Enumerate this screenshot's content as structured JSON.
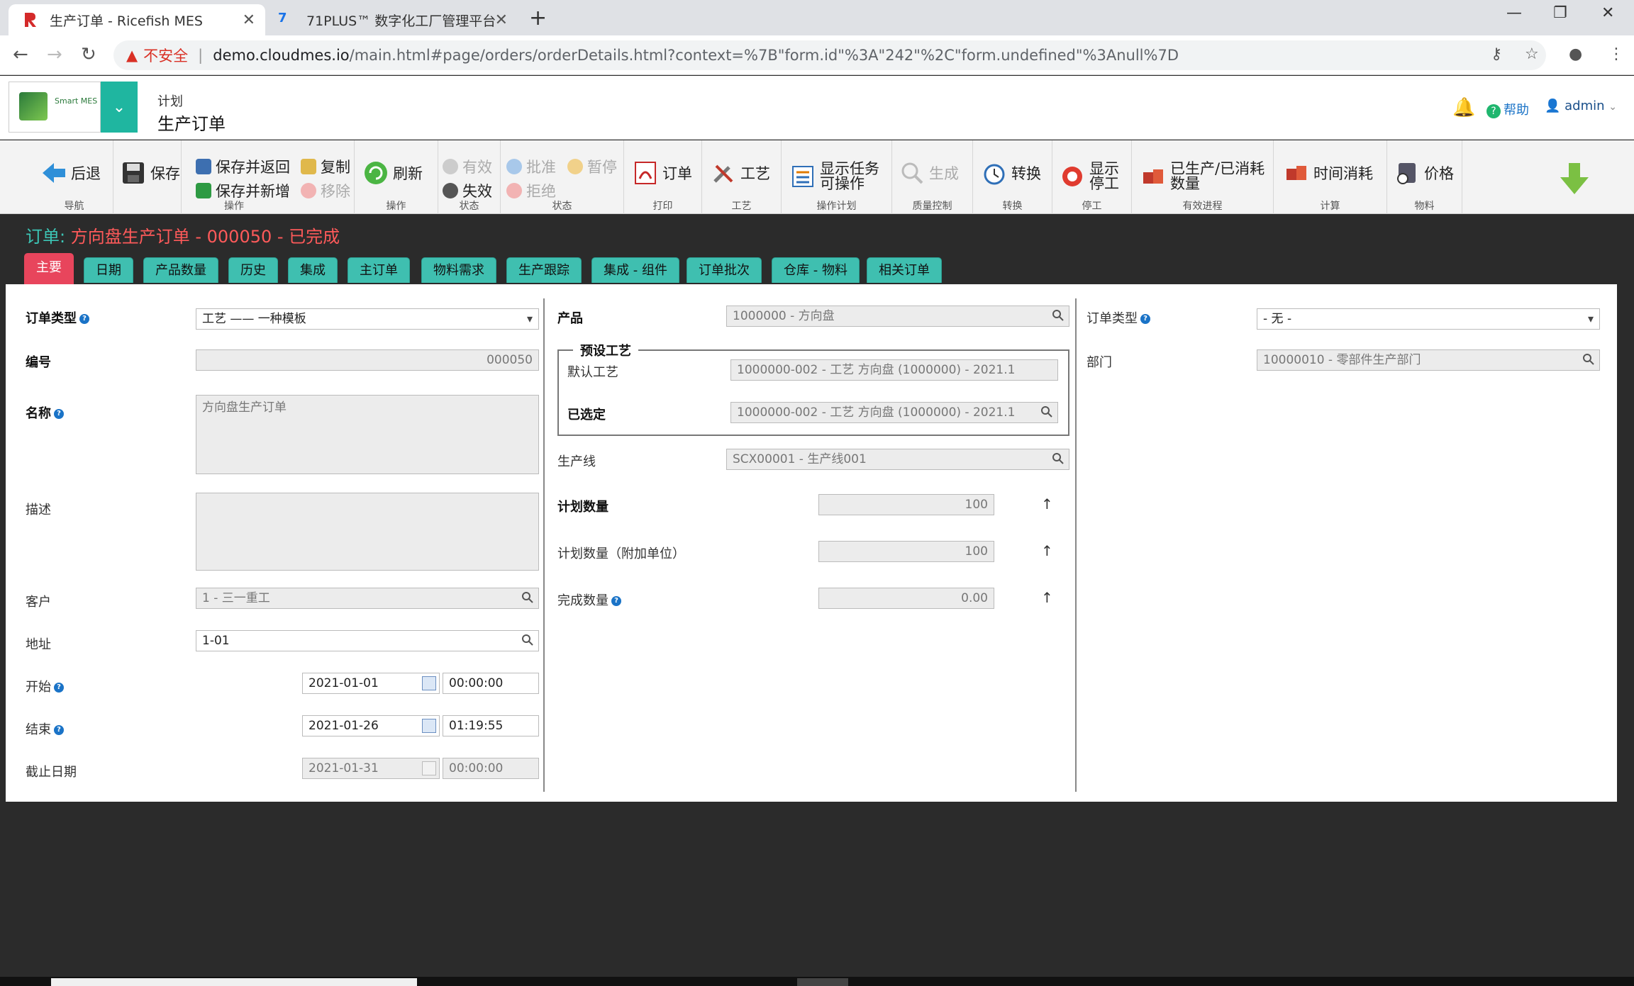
{
  "browser": {
    "tabs": [
      {
        "title": "生产订单 - Ricefish MES",
        "active": true
      },
      {
        "title": "71PLUS™ 数字化工厂管理平台",
        "active": false
      }
    ],
    "insecure_label": "不安全",
    "url_host": "demo.cloudmes.io",
    "url_path": "/main.html#page/orders/orderDetails.html?context=%7B\"form.id\"%3A\"242\"%2C\"form.undefined\"%3Anull%7D"
  },
  "header": {
    "logo_text": "Smart MES",
    "breadcrumb_parent": "计划",
    "page_title": "生产订单",
    "help_label": "帮助",
    "user_name": "admin"
  },
  "toolbar": {
    "back": "后退",
    "save": "保存",
    "save_return": "保存并返回",
    "save_new": "保存并新增",
    "copy": "复制",
    "remove": "移除",
    "refresh": "刷新",
    "valid": "有效",
    "invalid": "失效",
    "approve": "批准",
    "reject": "拒绝",
    "pause": "暂停",
    "order": "订单",
    "process": "工艺",
    "show_tasks_l1": "显示任务",
    "show_tasks_l2": "可操作",
    "generate": "生成",
    "convert": "转换",
    "show_stop_l1": "显示",
    "show_stop_l2": "停工",
    "produced_l1": "已生产/已消耗",
    "produced_l2": "数量",
    "time_consume": "时间消耗",
    "price": "价格",
    "groups": {
      "nav": "导航",
      "ops1": "操作",
      "ops2": "操作",
      "status1": "状态",
      "status2": "状态",
      "print": "打印",
      "process": "工艺",
      "op_plan": "操作计划",
      "quality": "质量控制",
      "convert": "转换",
      "stop": "停工",
      "progress": "有效进程",
      "calc": "计算",
      "material": "物料"
    }
  },
  "content": {
    "title_label": "订单: ",
    "title_value": "方向盘生产订单 - 000050 - 已完成"
  },
  "tabs": [
    "主要",
    "日期",
    "产品数量",
    "历史",
    "集成",
    "主订单",
    "物料需求",
    "生产跟踪",
    "集成 - 组件",
    "订单批次",
    "仓库 - 物料",
    "相关订单"
  ],
  "form": {
    "left": {
      "order_type_label": "订单类型",
      "order_type_value": "工艺 —— 一种模板",
      "number_label": "编号",
      "number_value": "000050",
      "name_label": "名称",
      "name_value": "方向盘生产订单",
      "desc_label": "描述",
      "desc_value": "",
      "customer_label": "客户",
      "customer_value": "1 - 三一重工",
      "address_label": "地址",
      "address_value": "1-01",
      "start_label": "开始",
      "start_date": "2021-01-01",
      "start_time": "00:00:00",
      "end_label": "结束",
      "end_date": "2021-01-26",
      "end_time": "01:19:55",
      "deadline_label": "截止日期",
      "deadline_date": "2021-01-31",
      "deadline_time": "00:00:00"
    },
    "middle": {
      "product_label": "产品",
      "product_value": "1000000 - 方向盘",
      "preset_legend": "预设工艺",
      "default_process_label": "默认工艺",
      "default_process_value": "1000000-002 - 工艺 方向盘 (1000000) - 2021.1",
      "selected_label": "已选定",
      "selected_value": "1000000-002 - 工艺 方向盘 (1000000) - 2021.1",
      "line_label": "生产线",
      "line_value": "SCX00001 - 生产线001",
      "planned_qty_label": "计划数量",
      "planned_qty_value": "100",
      "planned_qty_add_label": "计划数量（附加单位）",
      "planned_qty_add_value": "100",
      "done_qty_label": "完成数量",
      "done_qty_value": "0.00"
    },
    "right": {
      "order_type_label": "订单类型",
      "order_type_value": "- 无 -",
      "dept_label": "部门",
      "dept_value": "10000010 - 零部件生产部门"
    }
  },
  "colors": {
    "teal": "#1fb6a0",
    "tab_active": "#e8455c",
    "title_red": "#ff5a5a",
    "dark_bg": "#2b2b2b"
  }
}
